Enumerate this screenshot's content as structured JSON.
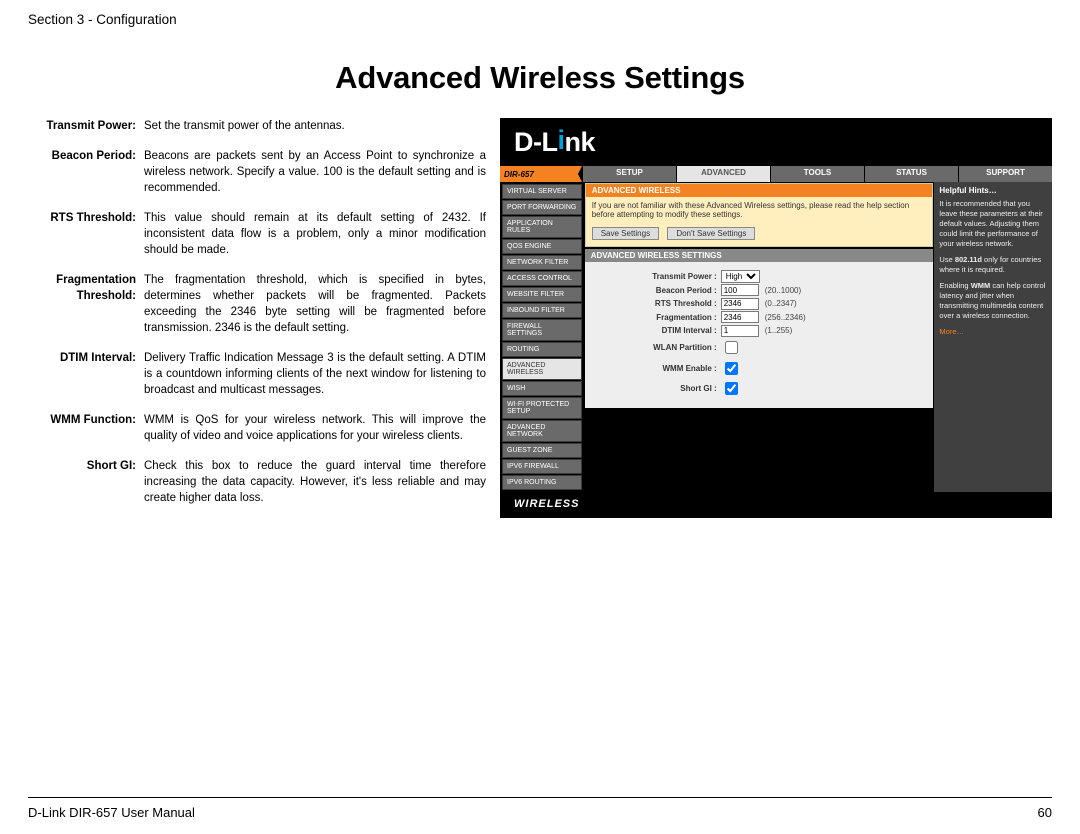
{
  "header": "Section 3 - Configuration",
  "title": "Advanced Wireless Settings",
  "definitions": [
    {
      "label": "Transmit Power:",
      "text": "Set the transmit power of the antennas."
    },
    {
      "label": "Beacon Period:",
      "text": "Beacons are packets sent by an Access Point to synchronize a wireless network. Specify a value. 100 is the default setting and is recommended."
    },
    {
      "label": "RTS Threshold:",
      "text": "This value should remain at its default setting of 2432. If inconsistent data flow is a problem, only a minor modification should be made."
    },
    {
      "label": "Fragmentation Threshold:",
      "text": "The fragmentation threshold, which is specified in bytes, determines whether packets will be fragmented. Packets exceeding the 2346 byte setting will be fragmented before transmission. 2346 is the default setting."
    },
    {
      "label": "DTIM Interval:",
      "text": "Delivery Traffic Indication Message 3 is the default setting. A DTIM is a countdown informing clients of the next window for listening to broadcast and multicast messages."
    },
    {
      "label": "WMM Function:",
      "text": "WMM is QoS for your wireless network. This will improve the quality of video and voice applications for your wireless clients."
    },
    {
      "label": "Short GI:",
      "text": "Check this box to reduce the guard interval time therefore increasing the data capacity. However, it's less reliable and may create higher data loss."
    }
  ],
  "router": {
    "brand": "D-Link",
    "model": "DIR-657",
    "tabs": [
      "SETUP",
      "ADVANCED",
      "TOOLS",
      "STATUS",
      "SUPPORT"
    ],
    "active_tab": "ADVANCED",
    "sidebar": [
      "VIRTUAL SERVER",
      "PORT FORWARDING",
      "APPLICATION RULES",
      "QOS ENGINE",
      "NETWORK FILTER",
      "ACCESS CONTROL",
      "WEBSITE FILTER",
      "INBOUND FILTER",
      "FIREWALL SETTINGS",
      "ROUTING",
      "ADVANCED WIRELESS",
      "WISH",
      "WI-FI PROTECTED SETUP",
      "ADVANCED NETWORK",
      "GUEST ZONE",
      "IPV6 FIREWALL",
      "IPV6 ROUTING"
    ],
    "active_sidebar": "ADVANCED WIRELESS",
    "notif": {
      "header": "ADVANCED WIRELESS",
      "text": "If you are not familiar with these Advanced Wireless settings, please read the help section before attempting to modify these settings.",
      "save": "Save Settings",
      "dont": "Don't Save Settings"
    },
    "settings": {
      "header": "ADVANCED WIRELESS SETTINGS",
      "rows": {
        "transmit_power_label": "Transmit Power :",
        "transmit_power_value": "High",
        "beacon_label": "Beacon Period :",
        "beacon_value": "100",
        "beacon_range": "(20..1000)",
        "rts_label": "RTS Threshold :",
        "rts_value": "2346",
        "rts_range": "(0..2347)",
        "frag_label": "Fragmentation :",
        "frag_value": "2346",
        "frag_range": "(256..2346)",
        "dtim_label": "DTIM Interval :",
        "dtim_value": "1",
        "dtim_range": "(1..255)",
        "wlan_label": "WLAN Partition :",
        "wmm_label": "WMM Enable :",
        "gi_label": "Short GI :"
      }
    },
    "hints": {
      "header": "Helpful Hints…",
      "p1": "It is recommended that you leave these parameters at their default values. Adjusting them could limit the performance of your wireless network.",
      "p2": "Use 802.11d only for countries where it is required.",
      "p3": "Enabling WMM can help control latency and jitter when transmitting multimedia content over a wireless connection.",
      "more": "More…"
    },
    "footer": "WIRELESS"
  },
  "footer": {
    "left": "D-Link DIR-657 User Manual",
    "page": "60"
  }
}
